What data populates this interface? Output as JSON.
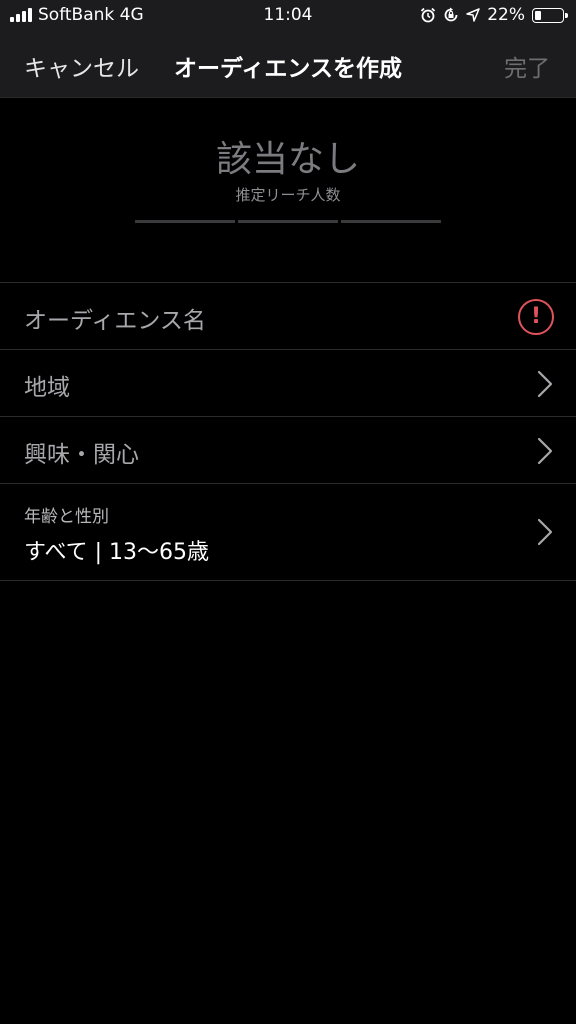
{
  "status_bar": {
    "carrier": "SoftBank 4G",
    "time": "11:04",
    "battery": "22%",
    "battery_level": 0.22
  },
  "navbar": {
    "cancel_label": "キャンセル",
    "title": "オーディエンスを作成",
    "done_label": "完了"
  },
  "reach": {
    "value": "該当なし",
    "label": "推定リーチ人数"
  },
  "list": {
    "items": [
      {
        "label": "オーディエンス名",
        "trailing": "alert-icon"
      },
      {
        "label": "地域",
        "trailing": "chevron-right-icon"
      },
      {
        "label": "興味・関心",
        "trailing": "chevron-right-icon"
      },
      {
        "label": "年齢と性別",
        "value": "すべて | 13〜65歳",
        "trailing": "chevron-right-icon"
      }
    ]
  },
  "colors": {
    "background": "#000000",
    "bar": "#1c1c1e",
    "alert": "#e0525c",
    "muted": "#6e6e72"
  }
}
